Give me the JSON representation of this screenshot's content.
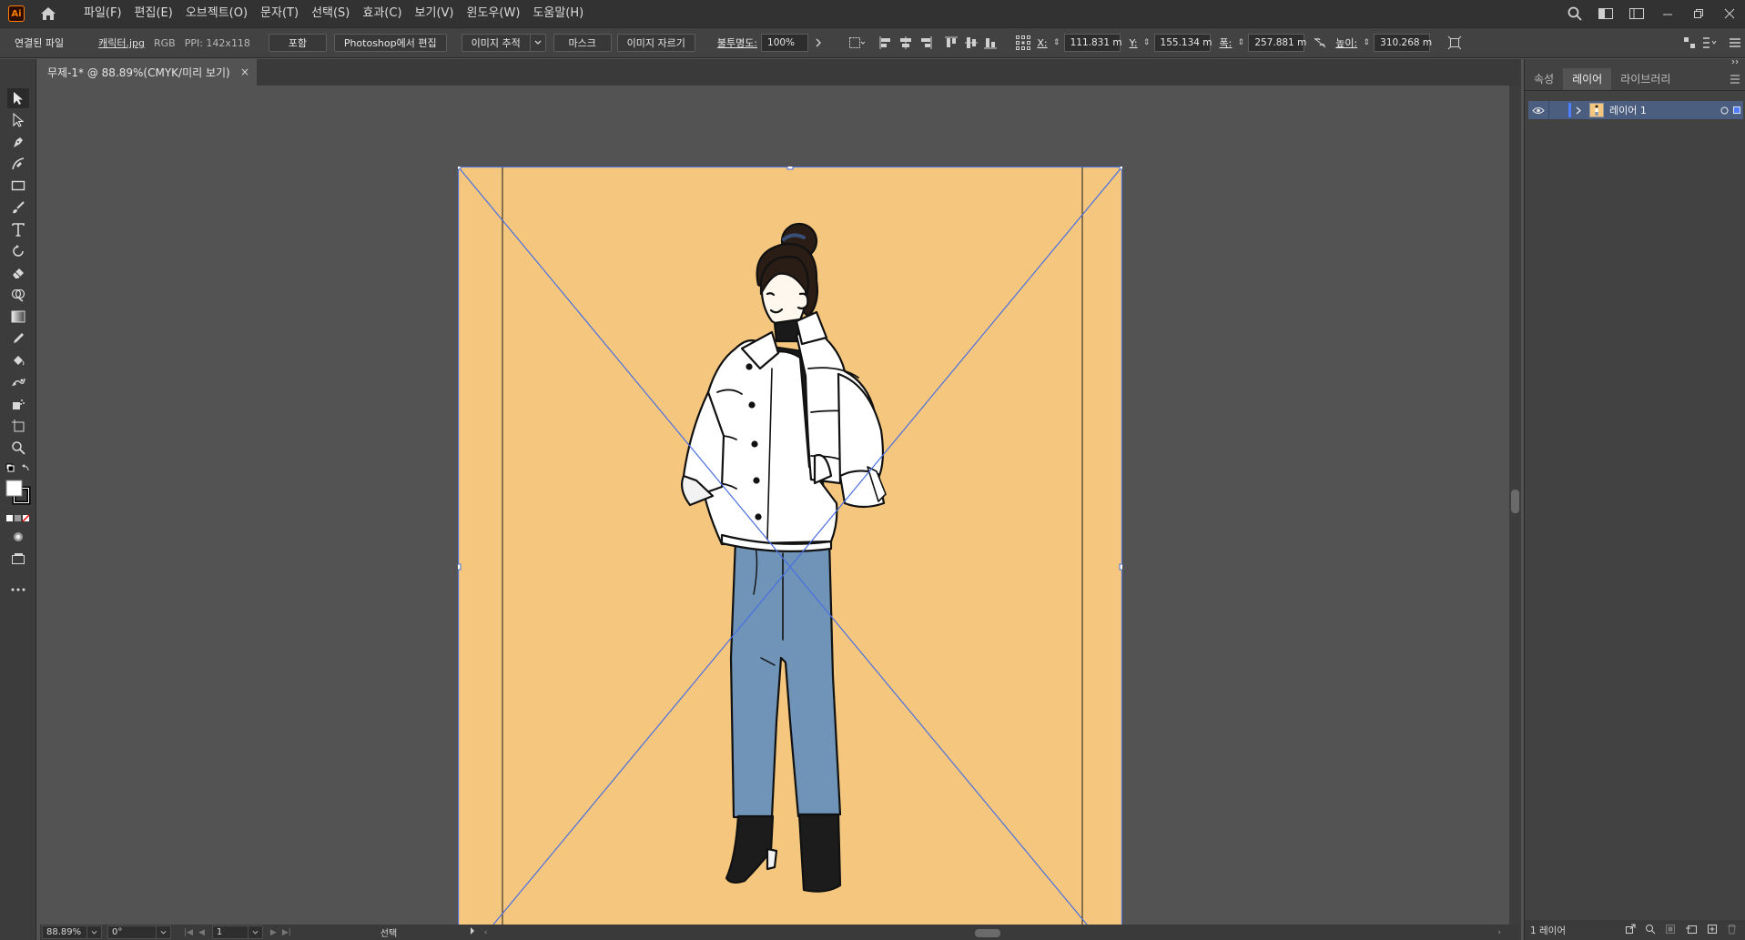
{
  "app": {
    "logo": "Ai"
  },
  "menu": {
    "items": [
      "파일(F)",
      "편집(E)",
      "오브젝트(O)",
      "문자(T)",
      "선택(S)",
      "효과(C)",
      "보기(V)",
      "윈도우(W)",
      "도움말(H)"
    ]
  },
  "control": {
    "linked_file_label": "연결된 파일",
    "filename": "캐릭터.jpg",
    "colormode": "RGB",
    "ppi": "PPI: 142x118",
    "embed_btn": "포함",
    "edit_ps_btn": "Photoshop에서 편집",
    "trace_btn": "이미지 추적",
    "mask_btn": "마스크",
    "crop_btn": "이미지 자르기",
    "opacity_label": "불투명도:",
    "opacity_value": "100%",
    "x_label": "X:",
    "x_value": "111.831 m",
    "y_label": "Y:",
    "y_value": "155.134 m",
    "w_label": "폭:",
    "w_value": "257.881 m",
    "h_label": "높이:",
    "h_value": "310.268 m"
  },
  "document": {
    "tab_title": "무제-1* @ 88.89%(CMYK/미리 보기)",
    "close": "×"
  },
  "status": {
    "zoom": "88.89%",
    "rotate": "0°",
    "page": "1",
    "mode": "선택"
  },
  "panel": {
    "tabs": [
      "속성",
      "레이어",
      "라이브러리"
    ],
    "active_tab": "레이어",
    "layer_name": "레이어 1",
    "footer_count": "1 레이어"
  },
  "colors": {
    "artboard": "#f5c77e",
    "selection": "#4a6fe0",
    "jacket": "#ffffff",
    "jeans": "#6f94b8",
    "boots": "#1c1c1c",
    "hair": "#2a1d16"
  }
}
